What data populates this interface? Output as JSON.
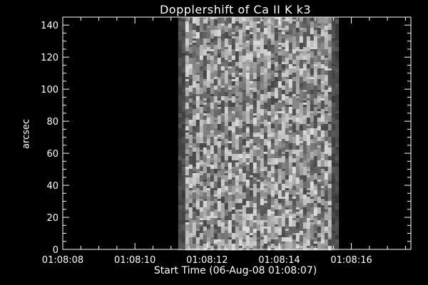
{
  "chart_data": {
    "type": "heatmap",
    "title": "Dopplershift of Ca II K k3",
    "xlabel": "Start Time (06-Aug-08 01:08:07)",
    "ylabel": "arcsec",
    "x_tick_labels": [
      "01:08:08",
      "01:08:10",
      "01:08:12",
      "01:08:14",
      "01:08:16"
    ],
    "x_tick_values_s": [
      1,
      3,
      5,
      7,
      9
    ],
    "xlim_s": [
      1,
      10.65
    ],
    "y_ticks": [
      0,
      20,
      40,
      60,
      80,
      100,
      120,
      140
    ],
    "ylim": [
      0,
      145
    ],
    "data_x_range_s": [
      4.2,
      8.65
    ],
    "colormap": "grayscale",
    "background_color": "#000000",
    "foreground_color": "#ffffff"
  }
}
